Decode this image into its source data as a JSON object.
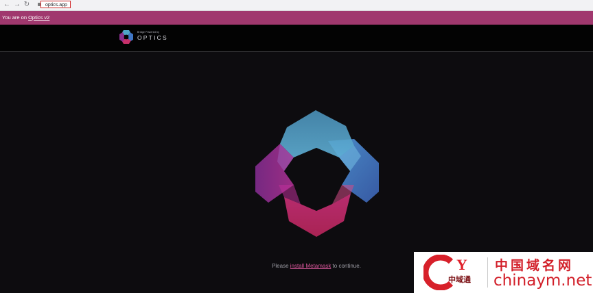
{
  "browser": {
    "back_icon": "←",
    "forward_icon": "→",
    "reload_icon": "↻",
    "url": "optics.app"
  },
  "banner": {
    "prefix": "You are on ",
    "link": "Optics v2"
  },
  "header": {
    "logo_tagline": "Bridge Powered by",
    "logo_name": "OPTICS"
  },
  "main": {
    "prompt_before": "Please ",
    "prompt_link": "install Metamask",
    "prompt_after": " to continue."
  },
  "watermark": {
    "letter": "Y",
    "small_text": "中域通",
    "cn_text": "中国域名网",
    "en_text": "chinaym.net"
  },
  "colors": {
    "banner": "#a0386e",
    "link": "#d8569a",
    "background": "#0d0c0f"
  }
}
